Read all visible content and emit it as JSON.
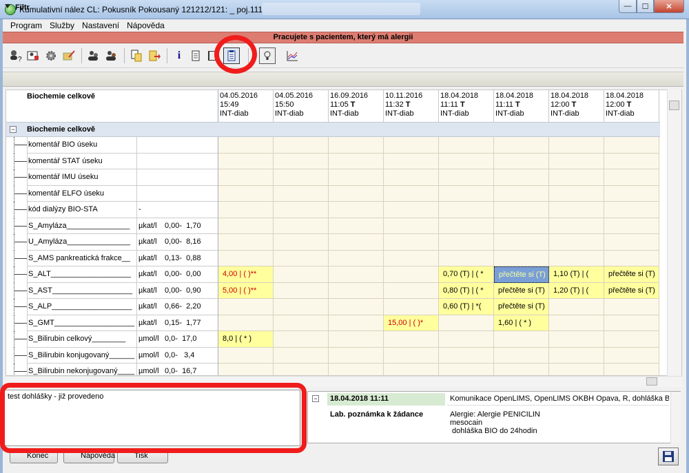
{
  "window": {
    "title": "Kumulativní nález CL: Pokusník Pokousaný 121212/121: _ poj.111",
    "min": "—",
    "max": "☐",
    "close": "✕"
  },
  "menu": [
    "Program",
    "Služby",
    "Nastavení",
    "Nápověda"
  ],
  "allergy_banner": "Pracujete s pacientem, který má alergii",
  "toolbar_icons": [
    "patient-search-icon",
    "patient-card-icon",
    "gear-icon",
    "edit-icon",
    "users-icon",
    "users-alt-icon",
    "copy-icon",
    "paste-icon",
    "info-icon",
    "document-icon",
    "book-icon",
    "clipboard-icon",
    "lightbulb-icon",
    "chart-icon"
  ],
  "filter": {
    "label": "Filtr"
  },
  "grid": {
    "header_title": "Biochemie celkově",
    "columns": [
      {
        "date": "04.05.2016",
        "time": "15:49",
        "flag": "",
        "unit": "INT-diab"
      },
      {
        "date": "04.05.2016",
        "time": "15:50",
        "flag": "",
        "unit": "INT-diab"
      },
      {
        "date": "16.09.2016",
        "time": "11:05",
        "flag": "T",
        "unit": "INT-diab"
      },
      {
        "date": "10.11.2016",
        "time": "11:32",
        "flag": "T",
        "unit": "INT-diab"
      },
      {
        "date": "18.04.2018",
        "time": "11:11",
        "flag": "T",
        "unit": "INT-diab"
      },
      {
        "date": "18.04.2018",
        "time": "11:11",
        "flag": "T",
        "unit": "INT-diab"
      },
      {
        "date": "18.04.2018",
        "time": "12:00",
        "flag": "T",
        "unit": "INT-diab"
      },
      {
        "date": "18.04.2018",
        "time": "12:00",
        "flag": "T",
        "unit": "INT-diab"
      }
    ],
    "section": {
      "label": "Biochemie celkově",
      "toggle": "−"
    },
    "rows": [
      {
        "name": "komentář BIO úseku",
        "unit": "",
        "range": "",
        "cells": [
          "",
          "",
          "",
          "",
          "",
          "",
          "",
          ""
        ]
      },
      {
        "name": "komentář STAT úseku",
        "unit": "",
        "range": "",
        "cells": [
          "",
          "",
          "",
          "",
          "",
          "",
          "",
          ""
        ]
      },
      {
        "name": "komentář IMU úseku",
        "unit": "",
        "range": "",
        "cells": [
          "",
          "",
          "",
          "",
          "",
          "",
          "",
          ""
        ]
      },
      {
        "name": "komentář ELFO úseku",
        "unit": "",
        "range": "",
        "cells": [
          "",
          "",
          "",
          "",
          "",
          "",
          "",
          ""
        ]
      },
      {
        "name": "kód dialýzy BIO-STA",
        "unit": "-",
        "range": "",
        "cells": [
          "",
          "",
          "",
          "",
          "",
          "",
          "",
          ""
        ]
      },
      {
        "name": "S_Amyláza_______________",
        "unit": "µkat/l",
        "range": "0,00-  1,70",
        "cells": [
          "",
          "",
          "",
          "",
          "",
          "",
          "",
          ""
        ]
      },
      {
        "name": "U_Amyláza_______________",
        "unit": "µkat/l",
        "range": "0,00-  8,16",
        "cells": [
          "",
          "",
          "",
          "",
          "",
          "",
          "",
          ""
        ]
      },
      {
        "name": "S_AMS pankreatická frakce__",
        "unit": "µkat/l",
        "range": "0,13-  0,88",
        "cells": [
          "",
          "",
          "",
          "",
          "",
          "",
          "",
          ""
        ]
      },
      {
        "name": "S_ALT___________________",
        "unit": "µkat/l",
        "range": "0,00-  0,00",
        "cells": [
          {
            "text": "4,00 |  (  )**",
            "style": "red"
          },
          "",
          "",
          "",
          {
            "text": "0,70 (T) |   ( *",
            "style": "y"
          },
          {
            "text": "přečtěte si (T)",
            "style": "sel"
          },
          {
            "text": "1,10 (T) |   (",
            "style": "y"
          },
          {
            "text": "přečtěte si (T)",
            "style": "y"
          }
        ]
      },
      {
        "name": "S_AST___________________",
        "unit": "µkat/l",
        "range": "0,00-  0,90",
        "cells": [
          {
            "text": "5,00 |  (  )**",
            "style": "red"
          },
          "",
          "",
          "",
          {
            "text": "0,80 (T) |   ( *",
            "style": "y"
          },
          {
            "text": "přečtěte si (T)",
            "style": "y"
          },
          {
            "text": "1,20 (T) |   (",
            "style": "y"
          },
          {
            "text": "přečtěte si (T)",
            "style": "y"
          }
        ]
      },
      {
        "name": "S_ALP___________________",
        "unit": "µkat/l",
        "range": "0,66-  2,20",
        "cells": [
          "",
          "",
          "",
          "",
          {
            "text": "0,60 (T) |   *(",
            "style": "y"
          },
          {
            "text": "přečtěte si (T)",
            "style": "y"
          },
          "",
          ""
        ]
      },
      {
        "name": "S_GMT___________________",
        "unit": "µkat/l",
        "range": "0,15-  1,77",
        "cells": [
          "",
          "",
          "",
          {
            "text": "15,00 |  (  )*",
            "style": "red"
          },
          "",
          {
            "text": "1,60 |   ( * )",
            "style": "y"
          },
          "",
          ""
        ]
      },
      {
        "name": "S_Bilirubin celkový________",
        "unit": "µmol/l",
        "range": "0,0-  17,0",
        "cells": [
          {
            "text": "8,0 |   ( * )",
            "style": "y"
          },
          "",
          "",
          "",
          "",
          "",
          "",
          ""
        ]
      },
      {
        "name": "S_Bilirubin konjugovaný______",
        "unit": "µmol/l",
        "range": "0,0-   3,4",
        "cells": [
          "",
          "",
          "",
          "",
          "",
          "",
          "",
          ""
        ]
      },
      {
        "name": "S_Bilirubin nekonjugovaný____",
        "unit": "µmol/l",
        "range": "0,0-  16,7",
        "cells": [
          "",
          "",
          "",
          "",
          "",
          "",
          "",
          ""
        ]
      }
    ]
  },
  "note_left": "test dohlášky - již provedeno",
  "note_right": {
    "toggle": "−",
    "date": "18.04.2018  11:11",
    "label": "Lab. poznámka k žádance",
    "info_line": "Komunikace OpenLIMS, OpenLIMS OKBH Opava, R,  dohláška BIO d",
    "info_body": "Alergie: Alergie PENICILIN\nmesocain\n dohláška BIO do 24hodin"
  },
  "footer": {
    "end": "Konec",
    "help": "Nápověda",
    "print": "Tisk"
  },
  "colors": {
    "allergy": "#dd7d72",
    "highlight": "#ffff9e",
    "selected": "#7a9fd6",
    "red": "#cc0000"
  }
}
